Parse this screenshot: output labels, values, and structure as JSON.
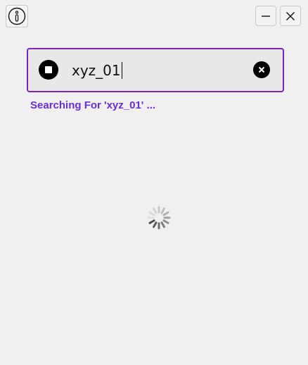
{
  "header": {
    "info_icon": "info-icon",
    "minimize_icon": "minimize-icon",
    "close_icon": "close-icon"
  },
  "search": {
    "value": "xyz_01",
    "stop_icon": "stop-icon",
    "clear_icon": "clear-icon",
    "accent_color": "#7a22c2"
  },
  "status": {
    "text": "Searching For 'xyz_01' ...",
    "color": "#6a2ed8"
  },
  "loader": {
    "icon": "loading-spinner-icon"
  }
}
